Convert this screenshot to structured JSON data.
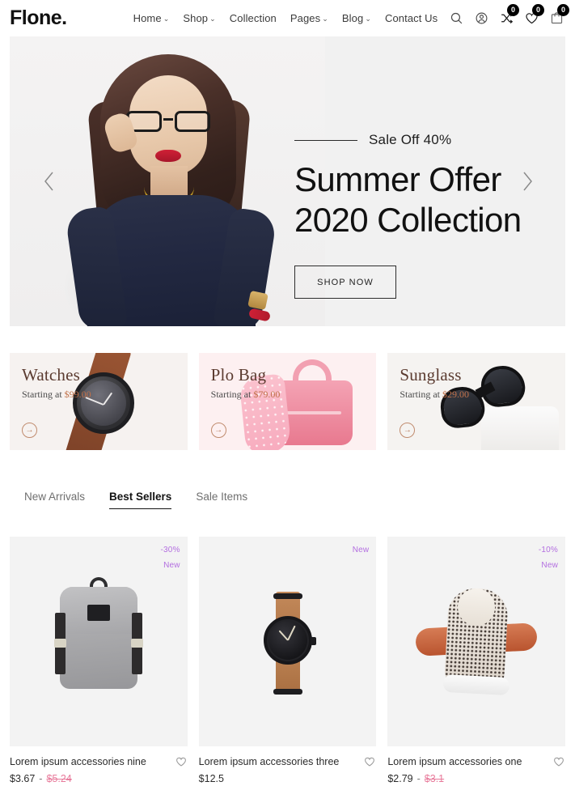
{
  "brand": {
    "logo": "Flone."
  },
  "nav": {
    "items": [
      {
        "label": "Home",
        "has_dropdown": true
      },
      {
        "label": "Shop",
        "has_dropdown": true
      },
      {
        "label": "Collection",
        "has_dropdown": false
      },
      {
        "label": "Pages",
        "has_dropdown": true
      },
      {
        "label": "Blog",
        "has_dropdown": true
      },
      {
        "label": "Contact Us",
        "has_dropdown": false
      }
    ],
    "caret": "⌄"
  },
  "header_icons": {
    "search": "search-icon",
    "account": "user-icon",
    "compare": {
      "icon": "compare-icon",
      "count": "0"
    },
    "wishlist": {
      "icon": "heart-icon",
      "count": "0"
    },
    "cart": {
      "icon": "cart-icon",
      "count": "0"
    }
  },
  "hero": {
    "eyebrow": "Sale Off 40%",
    "title_line1": "Summer Offer",
    "title_line2": "2020 Collection",
    "button": "SHOP NOW",
    "prev": "‹",
    "next": "›"
  },
  "categories": [
    {
      "title": "Watches",
      "starting_label": "Starting at",
      "price": "$99.00",
      "arrow": "→",
      "bg": "#f6f2f0"
    },
    {
      "title": "Plo Bag",
      "starting_label": "Starting at",
      "price": "$79.00",
      "arrow": "→",
      "bg": "#fdf0f1"
    },
    {
      "title": "Sunglass",
      "starting_label": "Starting at",
      "price": "$29.00",
      "arrow": "→",
      "bg": "#f5f3f1"
    }
  ],
  "tabs": [
    {
      "label": "New Arrivals",
      "active": false
    },
    {
      "label": "Best Sellers",
      "active": true
    },
    {
      "label": "Sale Items",
      "active": false
    }
  ],
  "products": [
    {
      "title": "Lorem ipsum accessories nine",
      "price": "$3.67",
      "old_price": "$5.24",
      "dash": "-",
      "badges": [
        "-30%",
        "New"
      ],
      "wishlist_icon": "heart-icon"
    },
    {
      "title": "Lorem ipsum accessories three",
      "price": "$12.5",
      "old_price": "",
      "dash": "",
      "badges": [
        "New"
      ],
      "wishlist_icon": "heart-icon"
    },
    {
      "title": "Lorem ipsum accessories one",
      "price": "$2.79",
      "old_price": "$3.1",
      "dash": "-",
      "badges": [
        "-10%",
        "New"
      ],
      "wishlist_icon": "heart-icon"
    }
  ],
  "colors": {
    "badge_purple": "#b36ee0",
    "sale_pink": "#e87a9b",
    "category_title": "#5b3b30",
    "category_price": "#c0714a",
    "text_dark": "#2b2b2b"
  }
}
